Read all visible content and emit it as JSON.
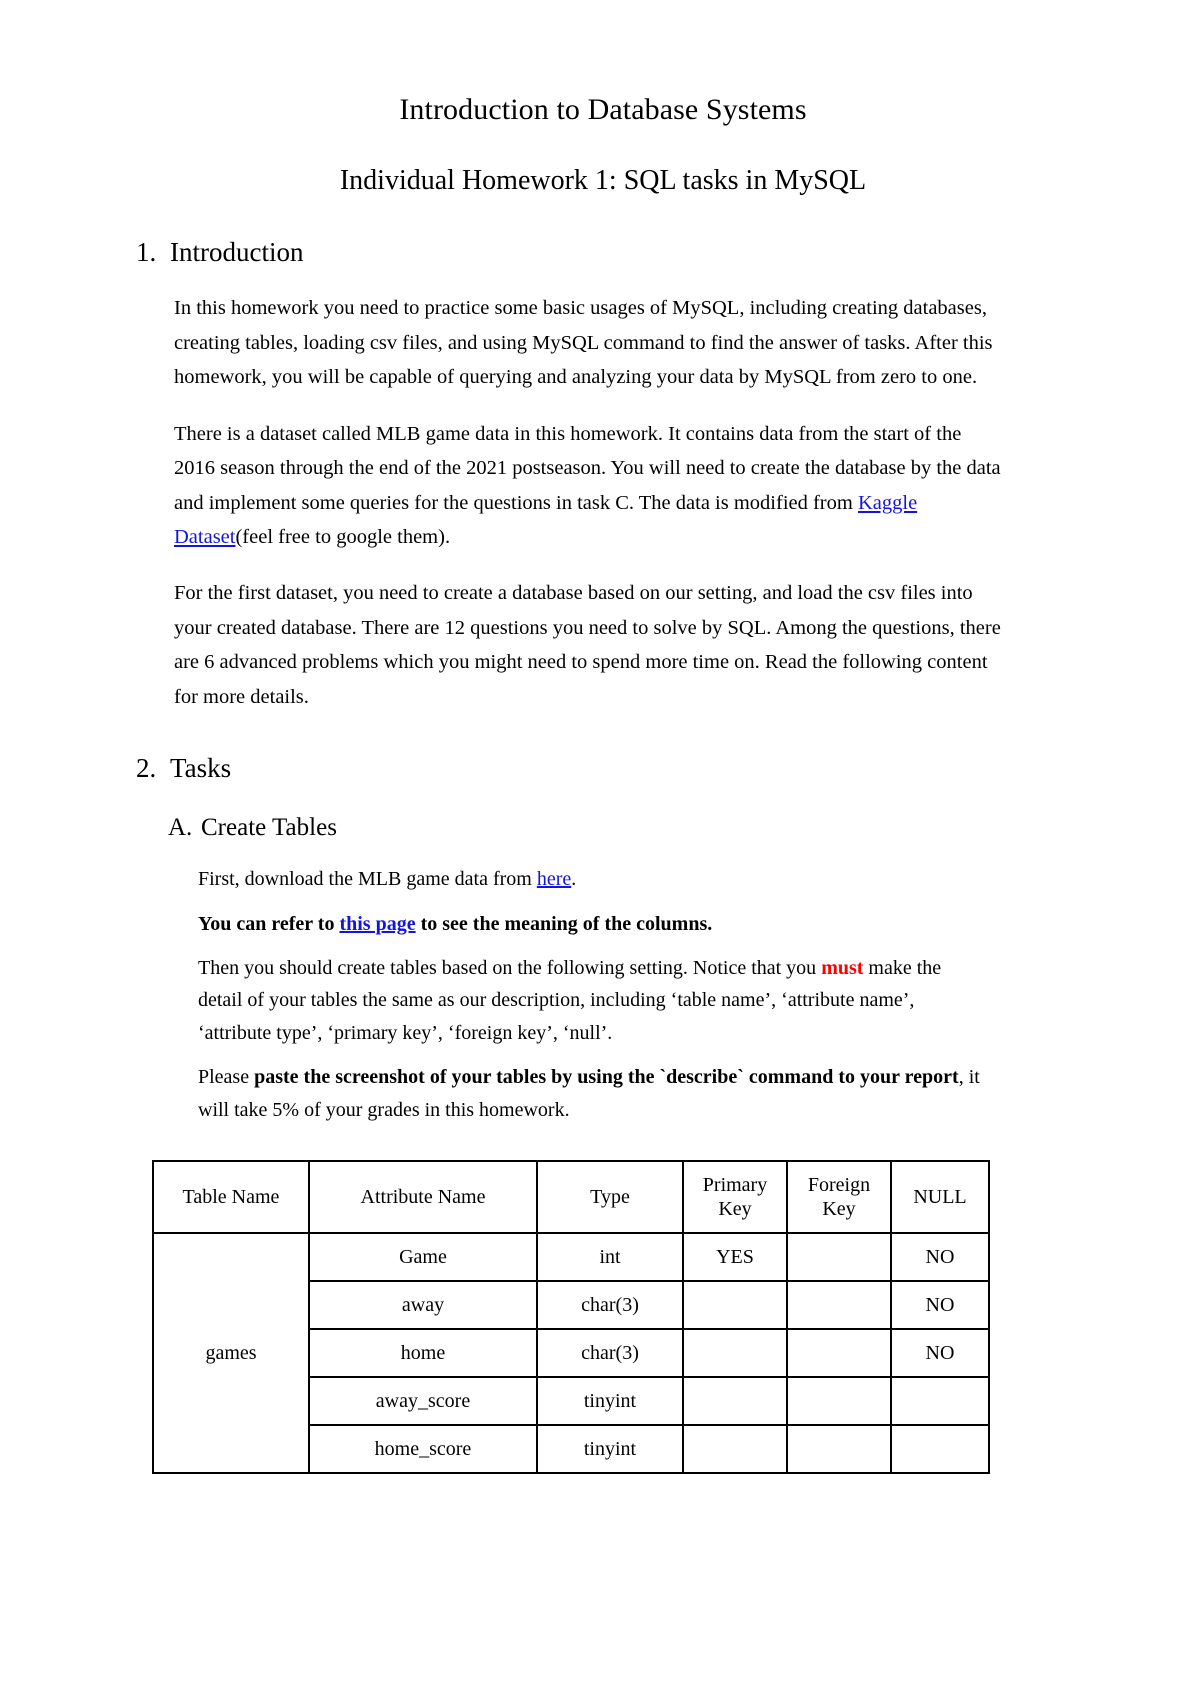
{
  "document": {
    "title": "Introduction to Database Systems",
    "subtitle": "Individual Homework 1: SQL tasks in MySQL"
  },
  "sections": {
    "introduction": {
      "marker": "1.",
      "heading": "Introduction",
      "paragraph_1": "In this homework you need to practice some basic usages of MySQL, including creating databases, creating tables, loading csv files, and using MySQL command to find the answer of tasks. After this homework, you will be capable of querying and analyzing your data by MySQL from zero to one.",
      "paragraph_2_before_link": "There is a dataset called MLB game data in this homework. It contains data from the start of the 2016 season through the end of the 2021 postseason. You will need to create the database by the data and implement some queries for the questions in task C. The data is modified from ",
      "paragraph_2_link": "Kaggle Dataset",
      "paragraph_2_after_link": "(feel free to google them).",
      "paragraph_3": "For the first dataset, you need to create a database based on our setting, and load the csv files into your created database. There are 12 questions you need to solve by SQL. Among the questions, there are 6 advanced problems which you might need to spend more time on. Read the following content for more details."
    },
    "tasks": {
      "marker": "2.",
      "heading": "Tasks",
      "create_tables": {
        "marker": "A.",
        "heading": "Create Tables",
        "line_1_before_link": "First, download the MLB game data from ",
        "line_1_link": "here",
        "line_1_after_link": ".",
        "line_2_before_link": "You can refer to ",
        "line_2_link": "this page",
        "line_2_after_link": " to see the meaning of the columns.",
        "line_3_part_1": "Then you should create tables based on the following setting. Notice that you ",
        "line_3_must": "must",
        "line_3_part_2": " make the detail of your tables the same as our description, including ‘table name’, ‘attribute name’, ‘attribute type’, ‘primary key’, ‘foreign key’, ‘null’.",
        "line_4_part_1": "Please ",
        "line_4_bold": "paste the screenshot of your tables by using the `describe` command to your report",
        "line_4_part_2": ", it will take 5% of your grades in this homework."
      }
    }
  },
  "schema_table": {
    "headers": [
      "Table Name",
      "Attribute Name",
      "Type",
      "Primary Key",
      "Foreign Key",
      "NULL"
    ],
    "headers_wrapped": {
      "primary_key_line_1": "Primary",
      "primary_key_line_2": "Key",
      "foreign_key_line_1": "Foreign",
      "foreign_key_line_2": "Key"
    },
    "table_name": "games",
    "rows": [
      {
        "attribute": "Game",
        "type": "int",
        "primary_key": "YES",
        "foreign_key": "",
        "null": "NO"
      },
      {
        "attribute": "away",
        "type": "char(3)",
        "primary_key": "",
        "foreign_key": "",
        "null": "NO"
      },
      {
        "attribute": "home",
        "type": "char(3)",
        "primary_key": "",
        "foreign_key": "",
        "null": "NO"
      },
      {
        "attribute": "away_score",
        "type": "tinyint",
        "primary_key": "",
        "foreign_key": "",
        "null": ""
      },
      {
        "attribute": "home_score",
        "type": "tinyint",
        "primary_key": "",
        "foreign_key": "",
        "null": ""
      }
    ]
  },
  "colors": {
    "link": "#1414e0",
    "emphasis_red": "#ff0000",
    "text": "#000000",
    "page_background": "#ffffff",
    "table_border": "#000000"
  }
}
